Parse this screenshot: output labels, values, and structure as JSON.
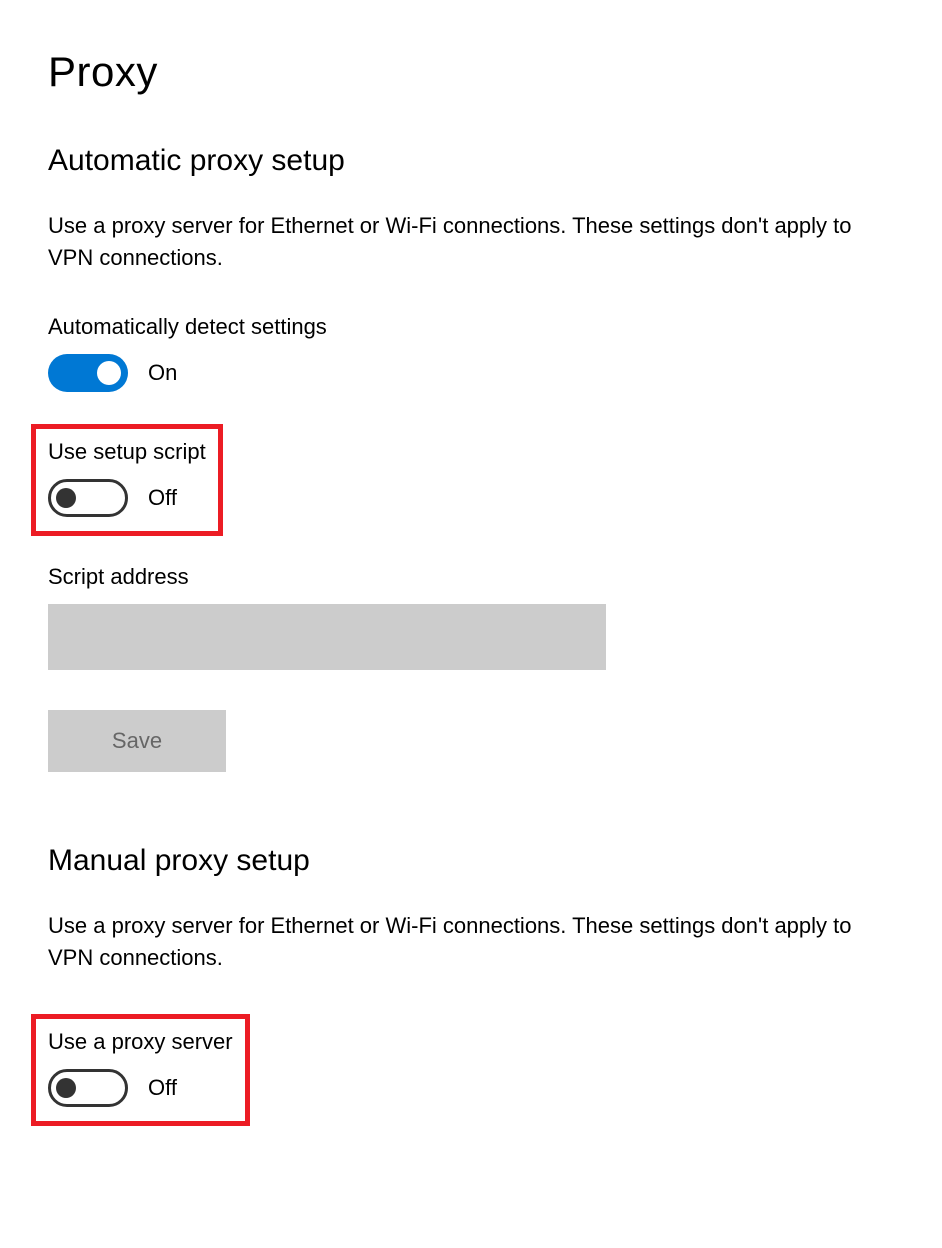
{
  "page": {
    "title": "Proxy"
  },
  "automatic": {
    "heading": "Automatic proxy setup",
    "description": "Use a proxy server for Ethernet or Wi-Fi connections. These settings don't apply to VPN connections.",
    "auto_detect": {
      "label": "Automatically detect settings",
      "state": "On",
      "on": true
    },
    "setup_script": {
      "label": "Use setup script",
      "state": "Off",
      "on": false
    },
    "script_address": {
      "label": "Script address",
      "value": ""
    },
    "save_label": "Save"
  },
  "manual": {
    "heading": "Manual proxy setup",
    "description": "Use a proxy server for Ethernet or Wi-Fi connections. These settings don't apply to VPN connections.",
    "use_proxy": {
      "label": "Use a proxy server",
      "state": "Off",
      "on": false
    }
  }
}
